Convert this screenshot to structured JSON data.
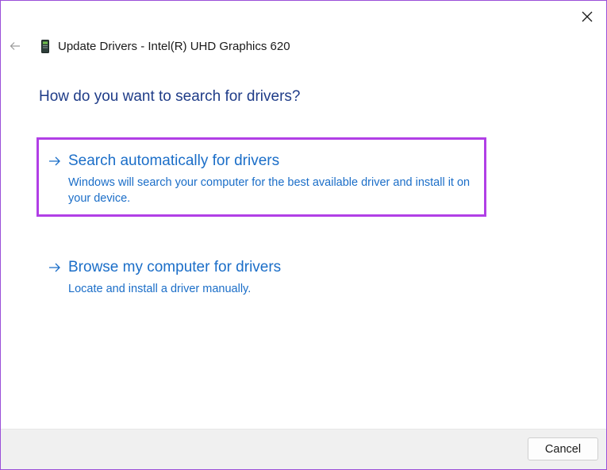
{
  "window": {
    "title": "Update Drivers - Intel(R) UHD Graphics 620",
    "icons": {
      "back": "arrow-left-icon",
      "device": "display-adapter-icon",
      "close": "close-icon"
    }
  },
  "main": {
    "heading": "How do you want to search for drivers?",
    "options": [
      {
        "title": "Search automatically for drivers",
        "description": "Windows will search your computer for the best available driver and install it on your device.",
        "selected": true
      },
      {
        "title": "Browse my computer for drivers",
        "description": "Locate and install a driver manually.",
        "selected": false
      }
    ]
  },
  "footer": {
    "cancel_label": "Cancel"
  },
  "colors": {
    "accent_link": "#1b6ec8",
    "heading": "#1f3c88",
    "highlight_border": "#b13fe6",
    "footer_bg": "#f0f0f0"
  }
}
